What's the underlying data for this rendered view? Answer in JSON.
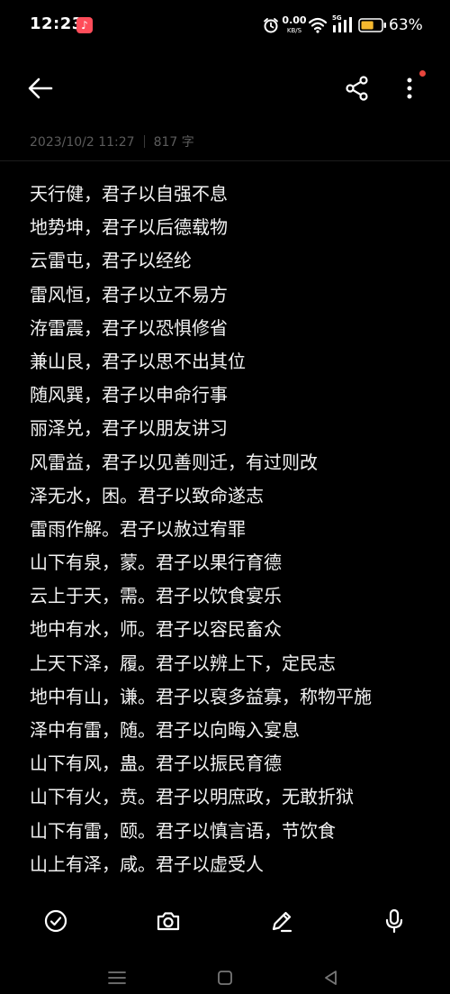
{
  "status_bar": {
    "time": "12:23",
    "net_speed_value": "0.00",
    "net_speed_unit": "KB/S",
    "network_type": "5G",
    "battery_percent": "63%",
    "battery_level": 0.63
  },
  "toolbar": {
    "back_icon": "arrow-left-icon",
    "share_icon": "share-icon",
    "more_icon": "more-vertical-icon"
  },
  "meta": {
    "date": "2023/10/2 11:27",
    "word_count": "817 字"
  },
  "note": {
    "lines": [
      "天行健，君子以自强不息",
      "地势坤，君子以后德载物",
      "云雷屯，君子以经纶",
      "雷风恒，君子以立不易方",
      "洊雷震，君子以恐惧修省",
      "兼山艮，君子以思不出其位",
      "随风巽，君子以申命行事",
      "丽泽兑，君子以朋友讲习",
      "风雷益，君子以见善则迁，有过则改",
      "泽无水，困。君子以致命遂志",
      "雷雨作解。君子以赦过宥罪",
      "山下有泉，蒙。君子以果行育德",
      "云上于天，需。君子以饮食宴乐",
      "地中有水，师。君子以容民畜众",
      "上天下泽，履。君子以辨上下，定民志",
      "地中有山，谦。君子以裒多益寡，称物平施",
      "泽中有雷，随。君子以向晦入宴息",
      "山下有风，蛊。君子以振民育德",
      "山下有火，贲。君子以明庶政，无敢折狱",
      "山下有雷，颐。君子以慎言语，节饮食",
      "山上有泽，咸。君子以虚受人"
    ]
  },
  "bottom_toolbar": {
    "icons": [
      "checklist-icon",
      "camera-icon",
      "pen-icon",
      "microphone-icon"
    ]
  },
  "colors": {
    "background": "#000000",
    "text": "#f2f2f2",
    "meta_text": "#5c5c5c",
    "notification_dot": "#e8453c",
    "music_app": "#ff4d5a",
    "battery_fill": "#f5b82e"
  }
}
